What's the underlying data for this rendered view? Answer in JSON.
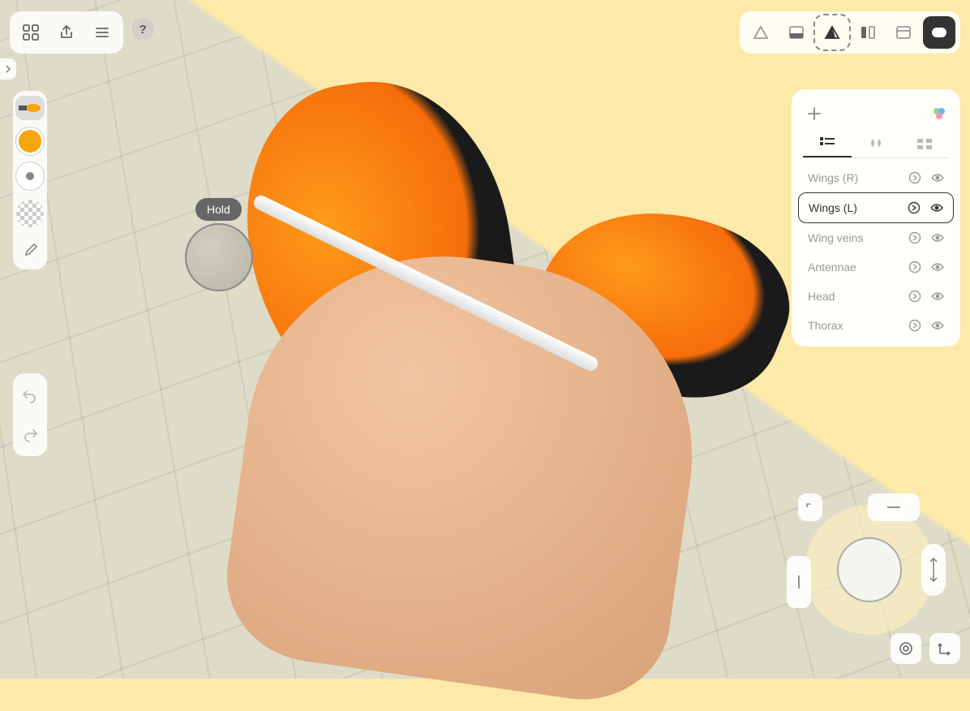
{
  "tooltip": {
    "hold": "Hold"
  },
  "layers_panel": {
    "tabs": [
      "layers",
      "materials",
      "groups"
    ],
    "items": [
      {
        "name": "Wings (R)",
        "selected": false
      },
      {
        "name": "Wings (L)",
        "selected": true
      },
      {
        "name": "Wing veins",
        "selected": false
      },
      {
        "name": "Antennae",
        "selected": false
      },
      {
        "name": "Head",
        "selected": false
      },
      {
        "name": "Thorax",
        "selected": false
      }
    ]
  },
  "colors": {
    "swatch": "#f5a60d",
    "canvas": "#dedcc9",
    "accent_yellow": "#fde9a8"
  },
  "help": {
    "label": "?"
  },
  "icons": {
    "grid": "grid",
    "share": "share",
    "menu": "menu",
    "perspective1": "triangle-outline",
    "perspective2": "dark-bottom",
    "perspective3": "triangle-fill",
    "mirror": "mirror",
    "window": "window",
    "pill": "pill",
    "brush": "brush",
    "color": "color",
    "size": "size",
    "opacity": "opacity",
    "picker": "picker",
    "undo": "undo",
    "redo": "redo",
    "add": "plus",
    "palette": "palette",
    "go": "arrow-circle",
    "eye": "eye",
    "center": "target",
    "axes": "axes"
  }
}
